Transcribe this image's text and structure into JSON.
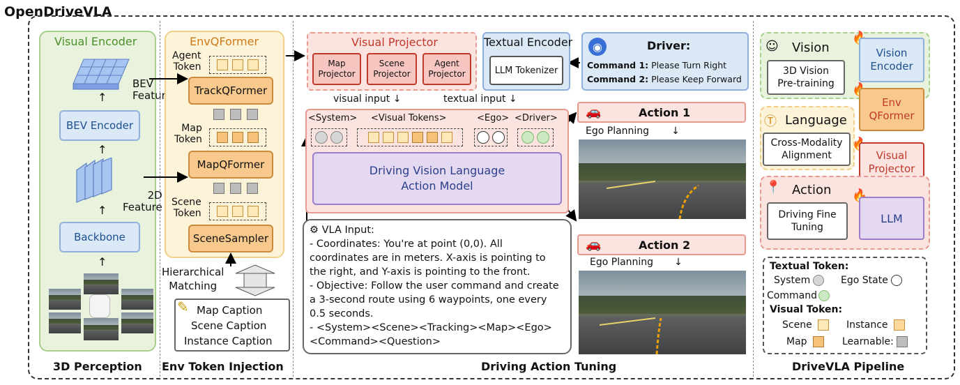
{
  "title": "OpenDriveVLA",
  "perception": {
    "section_label": "3D Perception",
    "visual_encoder": "Visual Encoder",
    "bev_feature": "BEV\nFeature",
    "bev_encoder": "BEV Encoder",
    "feature_2d": "2D\nFeature",
    "backbone": "Backbone"
  },
  "env": {
    "section_label": "Env Token Injection",
    "title": "EnvQFormer",
    "agent_token": "Agent\nToken",
    "track_qformer": "TrackQFormer",
    "map_token": "Map\nToken",
    "map_qformer": "MapQFormer",
    "scene_token": "Scene\nToken",
    "scene_sampler": "SceneSampler",
    "hierarchical": "Hierarchical\nMatching",
    "captions": [
      "Map Caption",
      "Scene Caption",
      "Instance Caption"
    ]
  },
  "tuning": {
    "section_label": "Driving Action Tuning",
    "visual_projector": "Visual Projector",
    "projectors": [
      "Map\nProjector",
      "Scene\nProjector",
      "Agent\nProjector"
    ],
    "textual_encoder": "Textual Encoder",
    "llm_tokenizer": "LLM Tokenizer",
    "driver_title": "Driver:",
    "command1_label": "Command 1:",
    "command1_text": " Please Turn Right",
    "command2_label": "Command 2:",
    "command2_text": " Please Keep Forward",
    "visual_input": "visual input",
    "textual_input": "textual input",
    "token_labels": [
      "<System>",
      "<Visual Tokens>",
      "<Ego>",
      "<Driver>"
    ],
    "model_name": "Driving Vision Language\nAction Model",
    "action1": "Action 1",
    "action2": "Action 2",
    "ego_planning": "Ego Planning",
    "vla_input_title": "VLA Input:",
    "vla_input_lines": [
      "- Coordinates: You're at point (0,0). All coordinates are in meters. X-axis is pointing to the right, and Y-axis is pointing to the front.",
      "- Objective: Follow the user command and create a 3-second route using 6 waypoints, one every 0.5 seconds.",
      "- <System><Scene><Tracking><Map><Ego> <Command><Question>"
    ]
  },
  "pipeline": {
    "section_label": "DriveVLA Pipeline",
    "vision": "Vision",
    "vision_pretrain": "3D Vision\nPre-training",
    "vision_encoder": "Vision\nEncoder",
    "env_qformer": "Env\nQFormer",
    "language": "Language",
    "alignment": "Cross-Modality\nAlignment",
    "visual_projector": "Visual\nProjector",
    "action": "Action",
    "fine_tuning": "Driving Fine\nTuning",
    "llm": "LLM"
  },
  "legend": {
    "textual_token": "Textual Token:",
    "system": "System",
    "ego_state": "Ego State",
    "command": "Command",
    "visual_token": "Visual Token:",
    "scene": "Scene",
    "instance": "Instance",
    "map": "Map",
    "learnable": "Learnable:"
  },
  "colors": {
    "green_panel": "#e8f2dc",
    "yellow_panel": "#fdf3d9",
    "pink_panel": "#fbe3e0",
    "blue_box": "#dbe8f6",
    "orange_box": "#f8c98c",
    "purple_box": "#e4d9f1"
  }
}
